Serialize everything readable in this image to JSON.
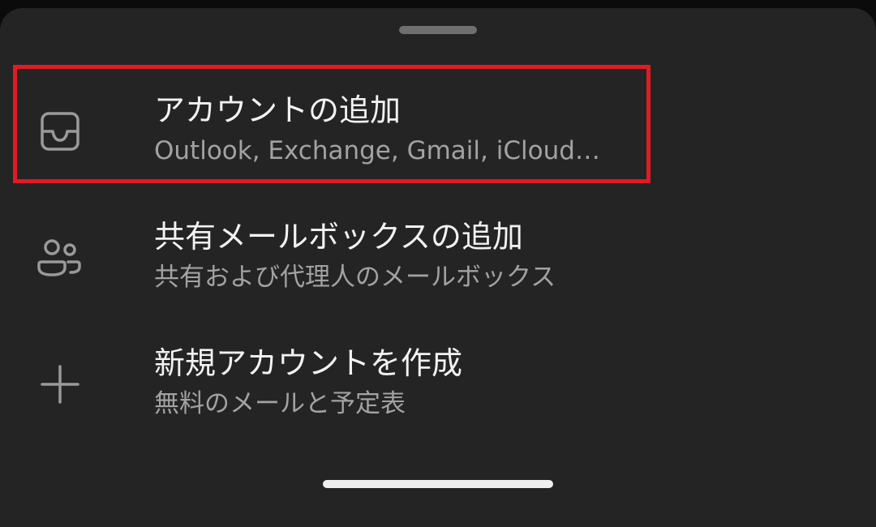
{
  "menu": {
    "items": [
      {
        "title": "アカウントの追加",
        "subtitle": "Outlook, Exchange, Gmail, iCloud…",
        "icon": "inbox-tray-icon"
      },
      {
        "title": "共有メールボックスの追加",
        "subtitle": "共有および代理人のメールボックス",
        "icon": "people-icon"
      },
      {
        "title": "新規アカウントを作成",
        "subtitle": "無料のメールと予定表",
        "icon": "plus-icon"
      }
    ]
  },
  "colors": {
    "sheet_background": "#242424",
    "highlight": "#e01b24",
    "title_text": "#f2f2f2",
    "subtitle_text": "#a2a2a2"
  }
}
